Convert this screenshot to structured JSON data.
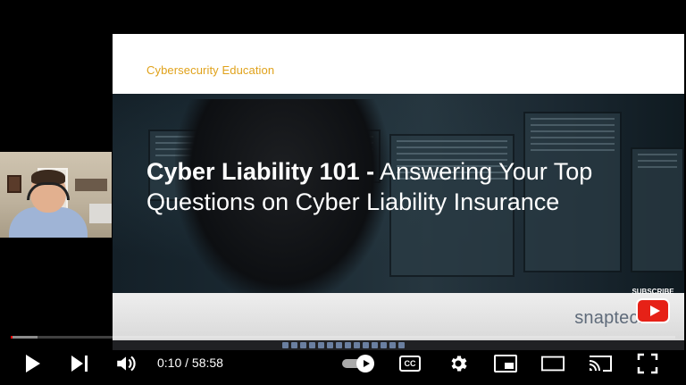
{
  "slide": {
    "label": "Cybersecurity Education",
    "title_bold": "Cyber Liability 101 -",
    "title_rest_line1": " Answering Your Top",
    "title_line2": "Questions on Cyber Liability Insurance",
    "brand": "snaptech"
  },
  "subscribe": {
    "label": "SUBSCRIBE"
  },
  "player": {
    "progress_played": 0.003,
    "progress_loaded": 0.04,
    "current_time": "0:10",
    "duration": "58:58",
    "time_display": "0:10 / 58:58",
    "accent_color": "#ff0000"
  },
  "controls": {
    "play": "play-icon",
    "next": "next-icon",
    "volume": "volume-icon",
    "autoplay": "autoplay-toggle-icon",
    "captions": "CC",
    "settings": "gear-icon",
    "miniplayer": "miniplayer-icon",
    "theater": "theater-mode-icon",
    "cast": "cast-icon",
    "fullscreen": "fullscreen-icon"
  }
}
